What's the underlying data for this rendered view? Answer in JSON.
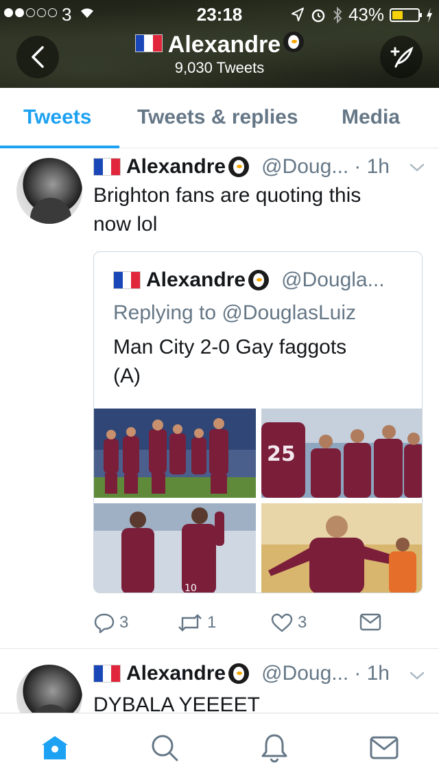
{
  "status_bar": {
    "carrier": "3",
    "time": "23:18",
    "battery_percent": "43%",
    "battery_level": 0.43,
    "signal_bars_filled": 2,
    "signal_bars_total": 5
  },
  "header": {
    "title": "Alexandre",
    "tweet_count": "9,030 Tweets"
  },
  "tabs": [
    {
      "label": "Tweets",
      "active": true
    },
    {
      "label": "Tweets & replies",
      "active": false
    },
    {
      "label": "Media",
      "active": false
    }
  ],
  "tweets": [
    {
      "name": "Alexandre",
      "handle": "@Doug...",
      "time": "· 1h",
      "text_line1": "Brighton fans are quoting this",
      "text_line2": "now lol",
      "quote": {
        "name": "Alexandre",
        "handle": "@Dougla...",
        "replying_to": "Replying to @DouglasLuiz",
        "text_line1": "Man City 2-0 Gay faggots",
        "text_line2": "(A)"
      },
      "actions": {
        "replies": "3",
        "retweets": "1",
        "likes": "3"
      }
    },
    {
      "name": "Alexandre",
      "handle": "@Doug...",
      "time": "· 1h",
      "text_line1": "DYBALA YEEEET"
    }
  ],
  "colors": {
    "accent": "#1da1f2",
    "secondary_text": "#657786",
    "primary_text": "#14171a",
    "kit_maroon": "#7a1e3a"
  },
  "icons": [
    "back-arrow-icon",
    "compose-feather-icon",
    "chevron-down-icon",
    "reply-icon",
    "retweet-icon",
    "like-icon",
    "dm-icon",
    "home-icon",
    "search-icon",
    "notifications-icon",
    "messages-icon"
  ]
}
